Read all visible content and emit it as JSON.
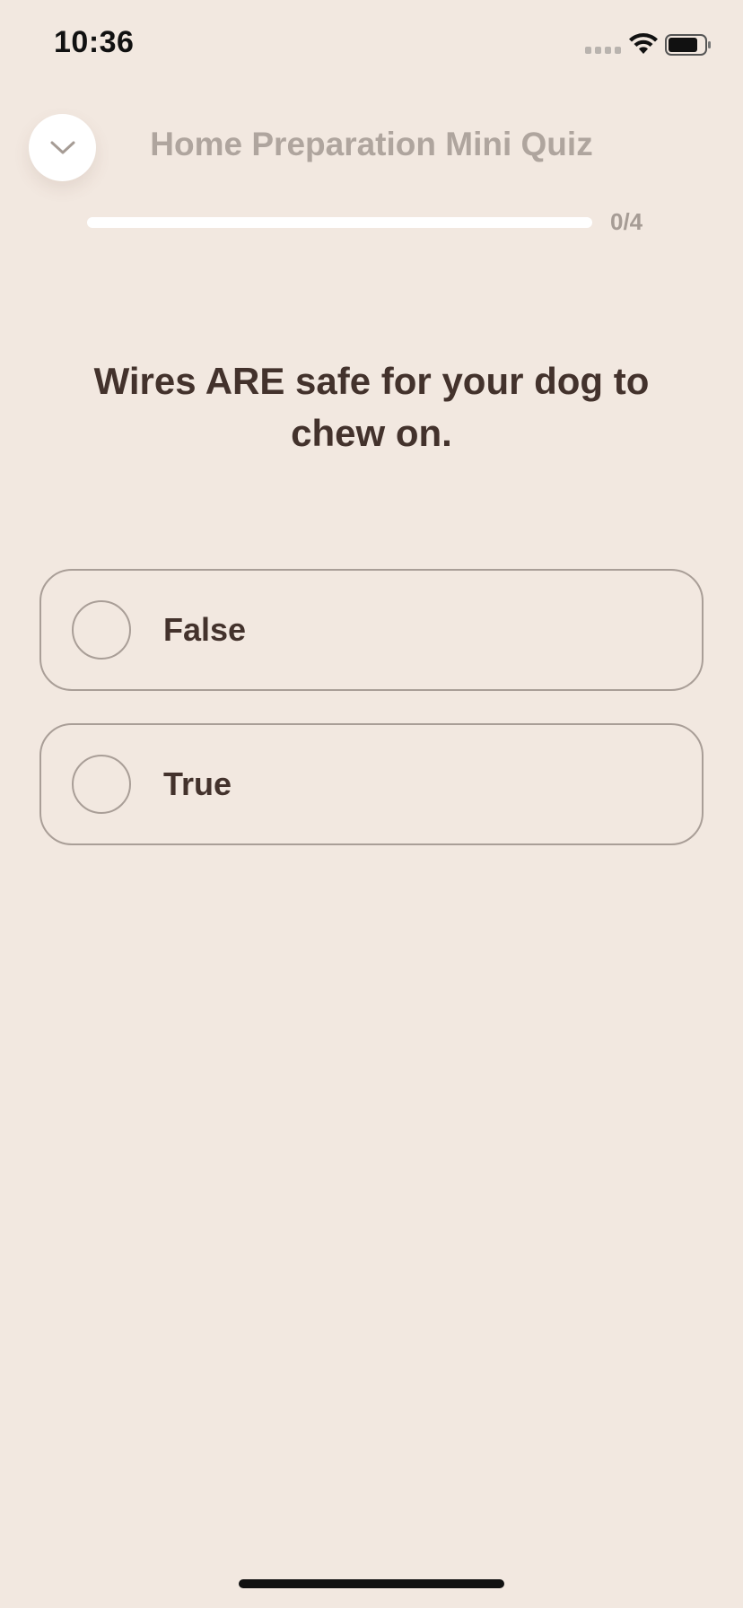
{
  "status_bar": {
    "time": "10:36"
  },
  "header": {
    "collapse_icon": "chevron-down-icon",
    "title": "Home Preparation Mini Quiz"
  },
  "progress": {
    "current": 0,
    "total": 4,
    "label": "0/4"
  },
  "question": {
    "text": "Wires ARE safe for your dog to chew on."
  },
  "options": [
    {
      "label": "False",
      "selected": false
    },
    {
      "label": "True",
      "selected": false
    }
  ],
  "colors": {
    "background": "#F2E8E0",
    "text_primary": "#43322C",
    "text_muted": "#AFA59E",
    "border": "#A99E97"
  }
}
